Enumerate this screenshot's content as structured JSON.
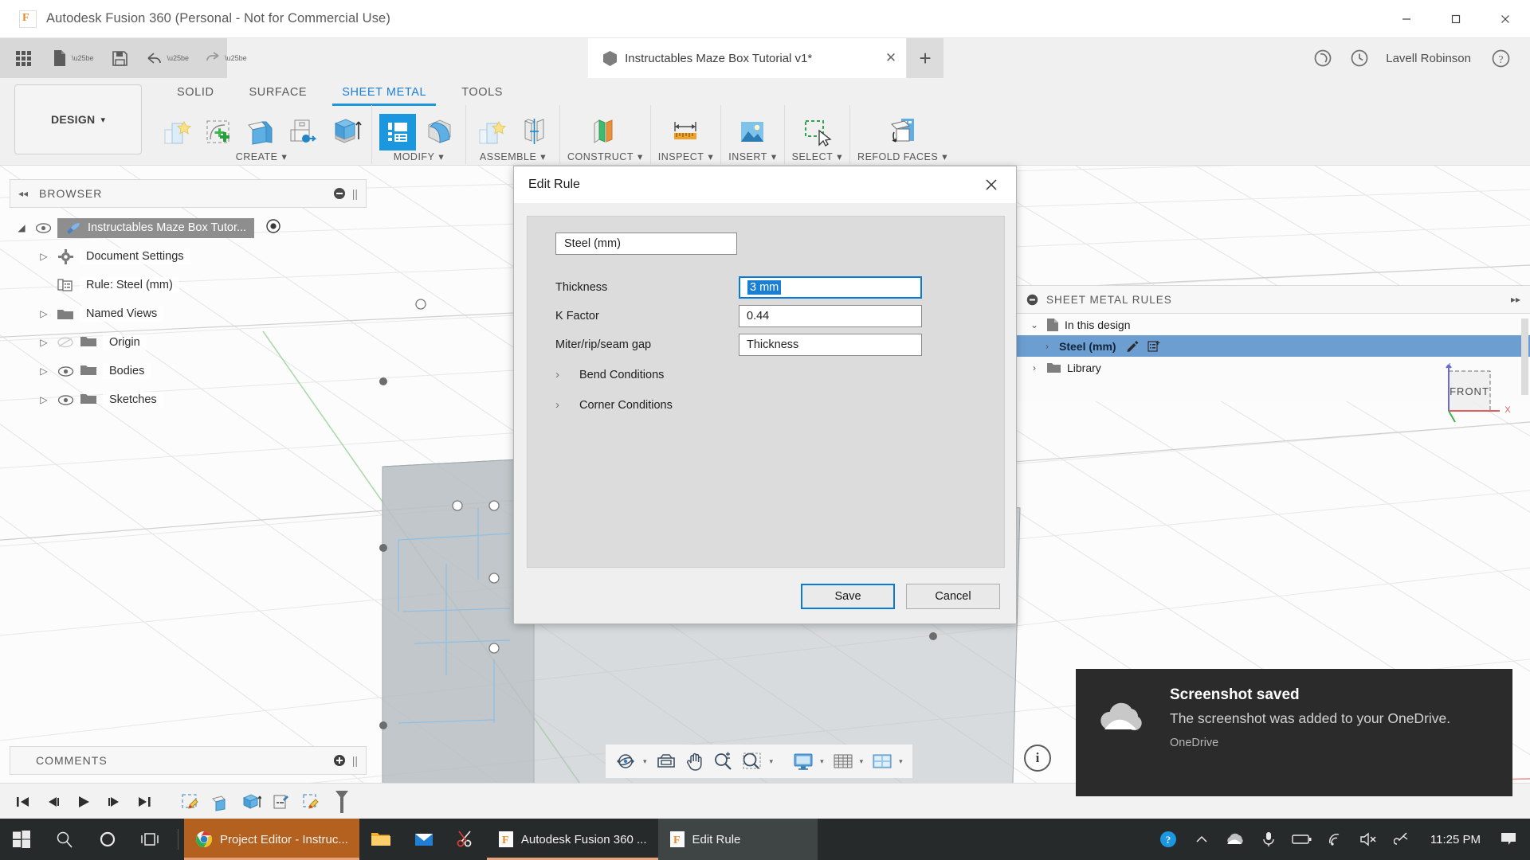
{
  "window": {
    "app_title": "Autodesk Fusion 360 (Personal - Not for Commercial Use)",
    "minimize_label": "–",
    "maximize_label": "☐",
    "close_label": "✕"
  },
  "appbar": {
    "document_tab": "Instructables Maze Box Tutorial v1*",
    "tab_close": "✕",
    "new_tab": "+",
    "username": "Lavell Robinson",
    "help_label": "?"
  },
  "ribbon": {
    "design_label": "DESIGN",
    "design_caret": "▾",
    "tabs": [
      {
        "label": "SOLID",
        "active": false
      },
      {
        "label": "SURFACE",
        "active": false
      },
      {
        "label": "SHEET METAL",
        "active": true
      },
      {
        "label": "TOOLS",
        "active": false
      }
    ],
    "panels": [
      {
        "label": "CREATE",
        "caret": "▾"
      },
      {
        "label": "MODIFY",
        "caret": "▾"
      },
      {
        "label": "ASSEMBLE",
        "caret": "▾"
      },
      {
        "label": "CONSTRUCT",
        "caret": "▾"
      },
      {
        "label": "INSPECT",
        "caret": "▾"
      },
      {
        "label": "INSERT",
        "caret": "▾"
      },
      {
        "label": "SELECT",
        "caret": "▾"
      },
      {
        "label": "REFOLD FACES",
        "caret": "▾"
      }
    ]
  },
  "browser": {
    "title": "BROWSER",
    "collapse_icon": "◂◂",
    "items": [
      {
        "label": "Instructables Maze Box Tutor...",
        "root": true,
        "arrow": "◢",
        "eye": true
      },
      {
        "label": "Document Settings",
        "arrow": "▷",
        "eye": false,
        "icon": "gear"
      },
      {
        "label": "Rule: Steel (mm)",
        "arrow": "",
        "eye": false,
        "icon": "rule"
      },
      {
        "label": "Named Views",
        "arrow": "▷",
        "eye": false,
        "icon": "folder"
      },
      {
        "label": "Origin",
        "arrow": "▷",
        "eye": true,
        "eye_off": true,
        "icon": "folder"
      },
      {
        "label": "Bodies",
        "arrow": "▷",
        "eye": true,
        "icon": "folder"
      },
      {
        "label": "Sketches",
        "arrow": "▷",
        "eye": true,
        "icon": "folder"
      }
    ]
  },
  "sheet_metal_rules": {
    "title": "SHEET METAL RULES",
    "expand_icon": "▸▸",
    "rows": [
      {
        "label": "In this design",
        "arrow": "⌄",
        "icon": "doc",
        "selected": false
      },
      {
        "label": "Steel (mm)",
        "arrow": "›",
        "icon": "none",
        "selected": true,
        "has_edit": true
      },
      {
        "label": "Library",
        "arrow": "›",
        "icon": "folder",
        "selected": false
      }
    ]
  },
  "dialog": {
    "title": "Edit Rule",
    "close_label": "✕",
    "rule_name": "Steel (mm)",
    "fields": [
      {
        "label": "Thickness",
        "value": "3 mm",
        "focused": true,
        "selected": true
      },
      {
        "label": "K Factor",
        "value": "0.44",
        "focused": false,
        "selected": false
      },
      {
        "label": "Miter/rip/seam gap",
        "value": "Thickness",
        "focused": false,
        "selected": false
      }
    ],
    "sections": [
      {
        "label": "Bend Conditions",
        "chevron": "›"
      },
      {
        "label": "Corner Conditions",
        "chevron": "›"
      }
    ],
    "save_label": "Save",
    "cancel_label": "Cancel"
  },
  "comments": {
    "title": "COMMENTS",
    "add_icon": "+"
  },
  "timeline": {
    "buttons": [
      "go-to-beginning",
      "step-back",
      "play",
      "step-forward",
      "go-to-end"
    ]
  },
  "viewcube": {
    "face_label": "FRONT",
    "axis_z": "Z",
    "axis_x": "X"
  },
  "info": {
    "label": "i"
  },
  "toast": {
    "title": "Screenshot saved",
    "message": "The screenshot was added to your OneDrive.",
    "app": "OneDrive"
  },
  "taskbar": {
    "apps": [
      {
        "label": "Project Editor - Instruc...",
        "kind": "chrome"
      },
      {
        "label": "",
        "kind": "explorer"
      },
      {
        "label": "",
        "kind": "mail"
      },
      {
        "label": "",
        "kind": "snip"
      },
      {
        "label": "Autodesk Fusion 360 ...",
        "kind": "fusion"
      },
      {
        "label": "Edit Rule",
        "kind": "fusion-active"
      }
    ],
    "clock": "11:25 PM"
  },
  "colors": {
    "accent_blue": "#1b97e0",
    "selection_blue": "#1b7fd4",
    "rule_selected": "#6d9ed1",
    "chrome_orange": "#b4601e",
    "taskbar": "#262a2b",
    "toast_bg": "#2b2b2b"
  }
}
